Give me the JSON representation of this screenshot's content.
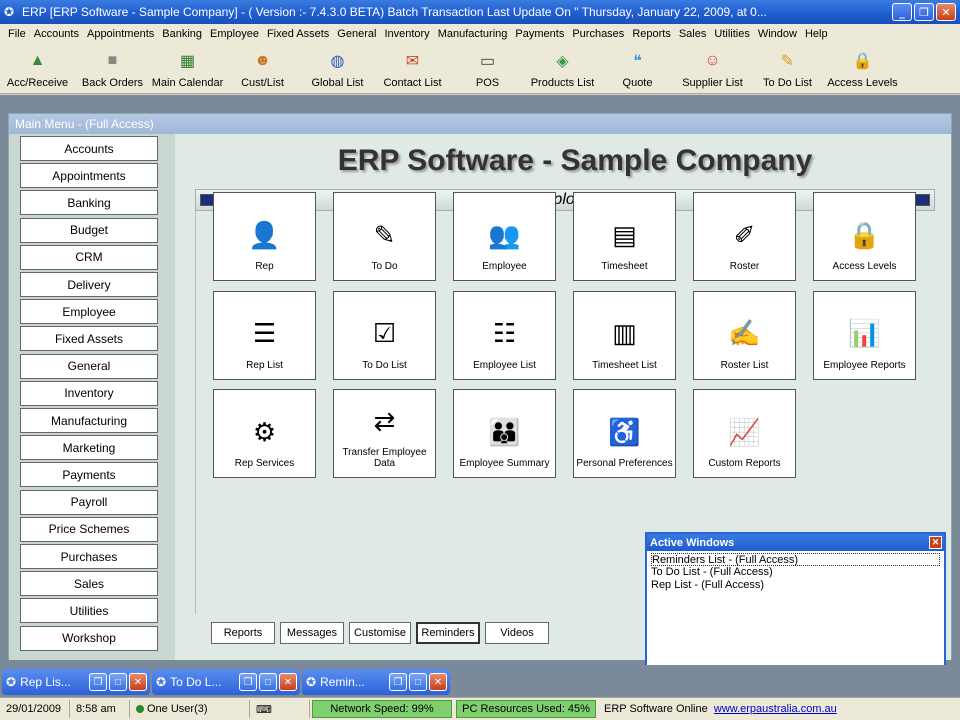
{
  "window": {
    "title": "ERP [ERP Software - Sample Company] -     ( Version :- 7.4.3.0  BETA)      Batch Transaction Last Update On \" Thursday, January 22, 2009,  at  0..."
  },
  "menu": [
    "File",
    "Accounts",
    "Appointments",
    "Banking",
    "Employee",
    "Fixed Assets",
    "General",
    "Inventory",
    "Manufacturing",
    "Payments",
    "Purchases",
    "Reports",
    "Sales",
    "Utilities",
    "Window",
    "Help"
  ],
  "toolbar": [
    {
      "label": "Acc/Receive",
      "icon": "chart-icon",
      "color": "#3a8a3a"
    },
    {
      "label": "Back Orders",
      "icon": "box-icon",
      "color": "#888888"
    },
    {
      "label": "Main Calendar",
      "icon": "calendar-icon",
      "color": "#2a7a2a"
    },
    {
      "label": "Cust/List",
      "icon": "people-icon",
      "color": "#c87a2a"
    },
    {
      "label": "Global List",
      "icon": "globe-icon",
      "color": "#2a5ab8"
    },
    {
      "label": "Contact List",
      "icon": "contact-icon",
      "color": "#c84a2a"
    },
    {
      "label": "POS",
      "icon": "pos-icon",
      "color": "#444444"
    },
    {
      "label": "Products List",
      "icon": "products-icon",
      "color": "#3a9a3a"
    },
    {
      "label": "Quote",
      "icon": "quote-icon",
      "color": "#3a9ae0"
    },
    {
      "label": "Supplier List",
      "icon": "supplier-icon",
      "color": "#c83a3a"
    },
    {
      "label": "To Do List",
      "icon": "todo-icon",
      "color": "#d8a020"
    },
    {
      "label": "Access Levels",
      "icon": "lock-icon",
      "color": "#c8a040"
    }
  ],
  "main_menu": {
    "title": "Main Menu - (Full Access)",
    "company": "ERP Software - Sample Company",
    "section": "Employee",
    "nav": [
      "Accounts",
      "Appointments",
      "Banking",
      "Budget",
      "CRM",
      "Delivery",
      "Employee",
      "Fixed Assets",
      "General",
      "Inventory",
      "Manufacturing",
      "Marketing",
      "Payments",
      "Payroll",
      "Price Schemes",
      "Purchases",
      "Sales",
      "Utilities",
      "Workshop"
    ],
    "tiles": [
      {
        "label": "Rep",
        "icon": "rep-icon"
      },
      {
        "label": "To Do",
        "icon": "todo-icon"
      },
      {
        "label": "Employee",
        "icon": "employee-icon"
      },
      {
        "label": "Timesheet",
        "icon": "timesheet-icon"
      },
      {
        "label": "Roster",
        "icon": "roster-icon"
      },
      {
        "label": "Access Levels",
        "icon": "lock-icon"
      },
      {
        "label": "Rep List",
        "icon": "rep-list-icon"
      },
      {
        "label": "To Do List",
        "icon": "todo-list-icon"
      },
      {
        "label": "Employee List",
        "icon": "employee-list-icon"
      },
      {
        "label": "Timesheet List",
        "icon": "timesheet-list-icon"
      },
      {
        "label": "Roster List",
        "icon": "roster-list-icon"
      },
      {
        "label": "Employee Reports",
        "icon": "reports-icon"
      },
      {
        "label": "Rep Services",
        "icon": "rep-services-icon"
      },
      {
        "label": "Transfer Employee Data",
        "icon": "transfer-icon"
      },
      {
        "label": "Employee Summary",
        "icon": "summary-icon"
      },
      {
        "label": "Personal Preferences",
        "icon": "preferences-icon"
      },
      {
        "label": "Custom Reports",
        "icon": "custom-reports-icon"
      }
    ],
    "bottom_tabs": [
      "Reports",
      "Messages",
      "Customise",
      "Reminders",
      "Videos"
    ],
    "active_bottom_tab": "Reminders"
  },
  "active_windows": {
    "title": "Active Windows",
    "items": [
      "Reminders List - (Full Access)",
      "To Do List - (Full Access)",
      "Rep List - (Full Access)"
    ]
  },
  "minimized": [
    "Rep Lis...",
    "To Do L...",
    "Remin..."
  ],
  "status": {
    "date": "29/01/2009",
    "time": "8:58 am",
    "users": "One User(3)",
    "network": "Network Speed: 99%",
    "resources": "PC Resources Used: 45%",
    "online": "ERP Software Online",
    "url": "www.erpaustralia.com.au"
  }
}
